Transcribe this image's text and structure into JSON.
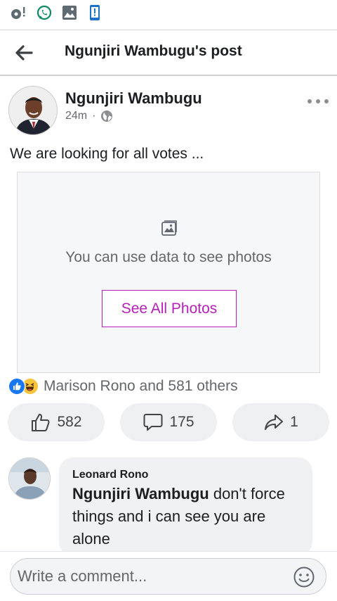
{
  "status_bar": {
    "icons": [
      "app-notification-icon",
      "whatsapp-icon",
      "gallery-icon",
      "phone-status-icon"
    ]
  },
  "header": {
    "title": "Ngunjiri Wambugu's post"
  },
  "post": {
    "author": "Ngunjiri Wambugu",
    "time": "24m",
    "separator": "·",
    "audience_icon": "globe-icon",
    "text": "We are looking for all votes ...",
    "photo_notice": "You can use data to see photos",
    "see_photos_label": "See All Photos"
  },
  "reactions": {
    "icons": [
      "like-reaction-icon",
      "haha-reaction-icon"
    ],
    "summary": "Marison Rono and 581 others"
  },
  "actions": {
    "like_count": "582",
    "comment_count": "175",
    "share_count": "1"
  },
  "comment": {
    "author": "Leonard Rono",
    "mention": "Ngunjiri Wambugu",
    "text": " don't force things and i can see you are alone"
  },
  "composer": {
    "placeholder": "Write a comment..."
  },
  "colors": {
    "accent_purple": "#b620b9",
    "facebook_blue": "#1877f2",
    "secondary_text": "#65676b"
  }
}
